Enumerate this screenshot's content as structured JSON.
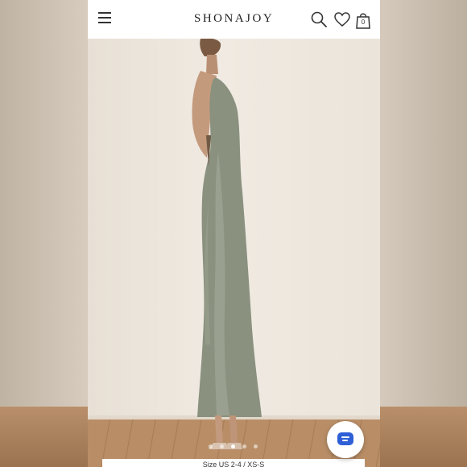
{
  "header": {
    "brand": "SHONAJOY",
    "cart_count": "0",
    "icons": [
      "menu-icon",
      "search-icon",
      "heart-icon",
      "shopping-bag-icon"
    ]
  },
  "gallery": {
    "slide_count": 5,
    "active_slide": 3,
    "product_image": "model wearing sage green satin halter slip midi dress, side view"
  },
  "size_label": "Size US 2-4 / XS-S",
  "chat": {
    "icon": "chat-icon",
    "accent": "#2f5fd6"
  },
  "colors": {
    "dress": "#8a917f",
    "wall": "#ece6dd",
    "floor": "#b38a63"
  }
}
